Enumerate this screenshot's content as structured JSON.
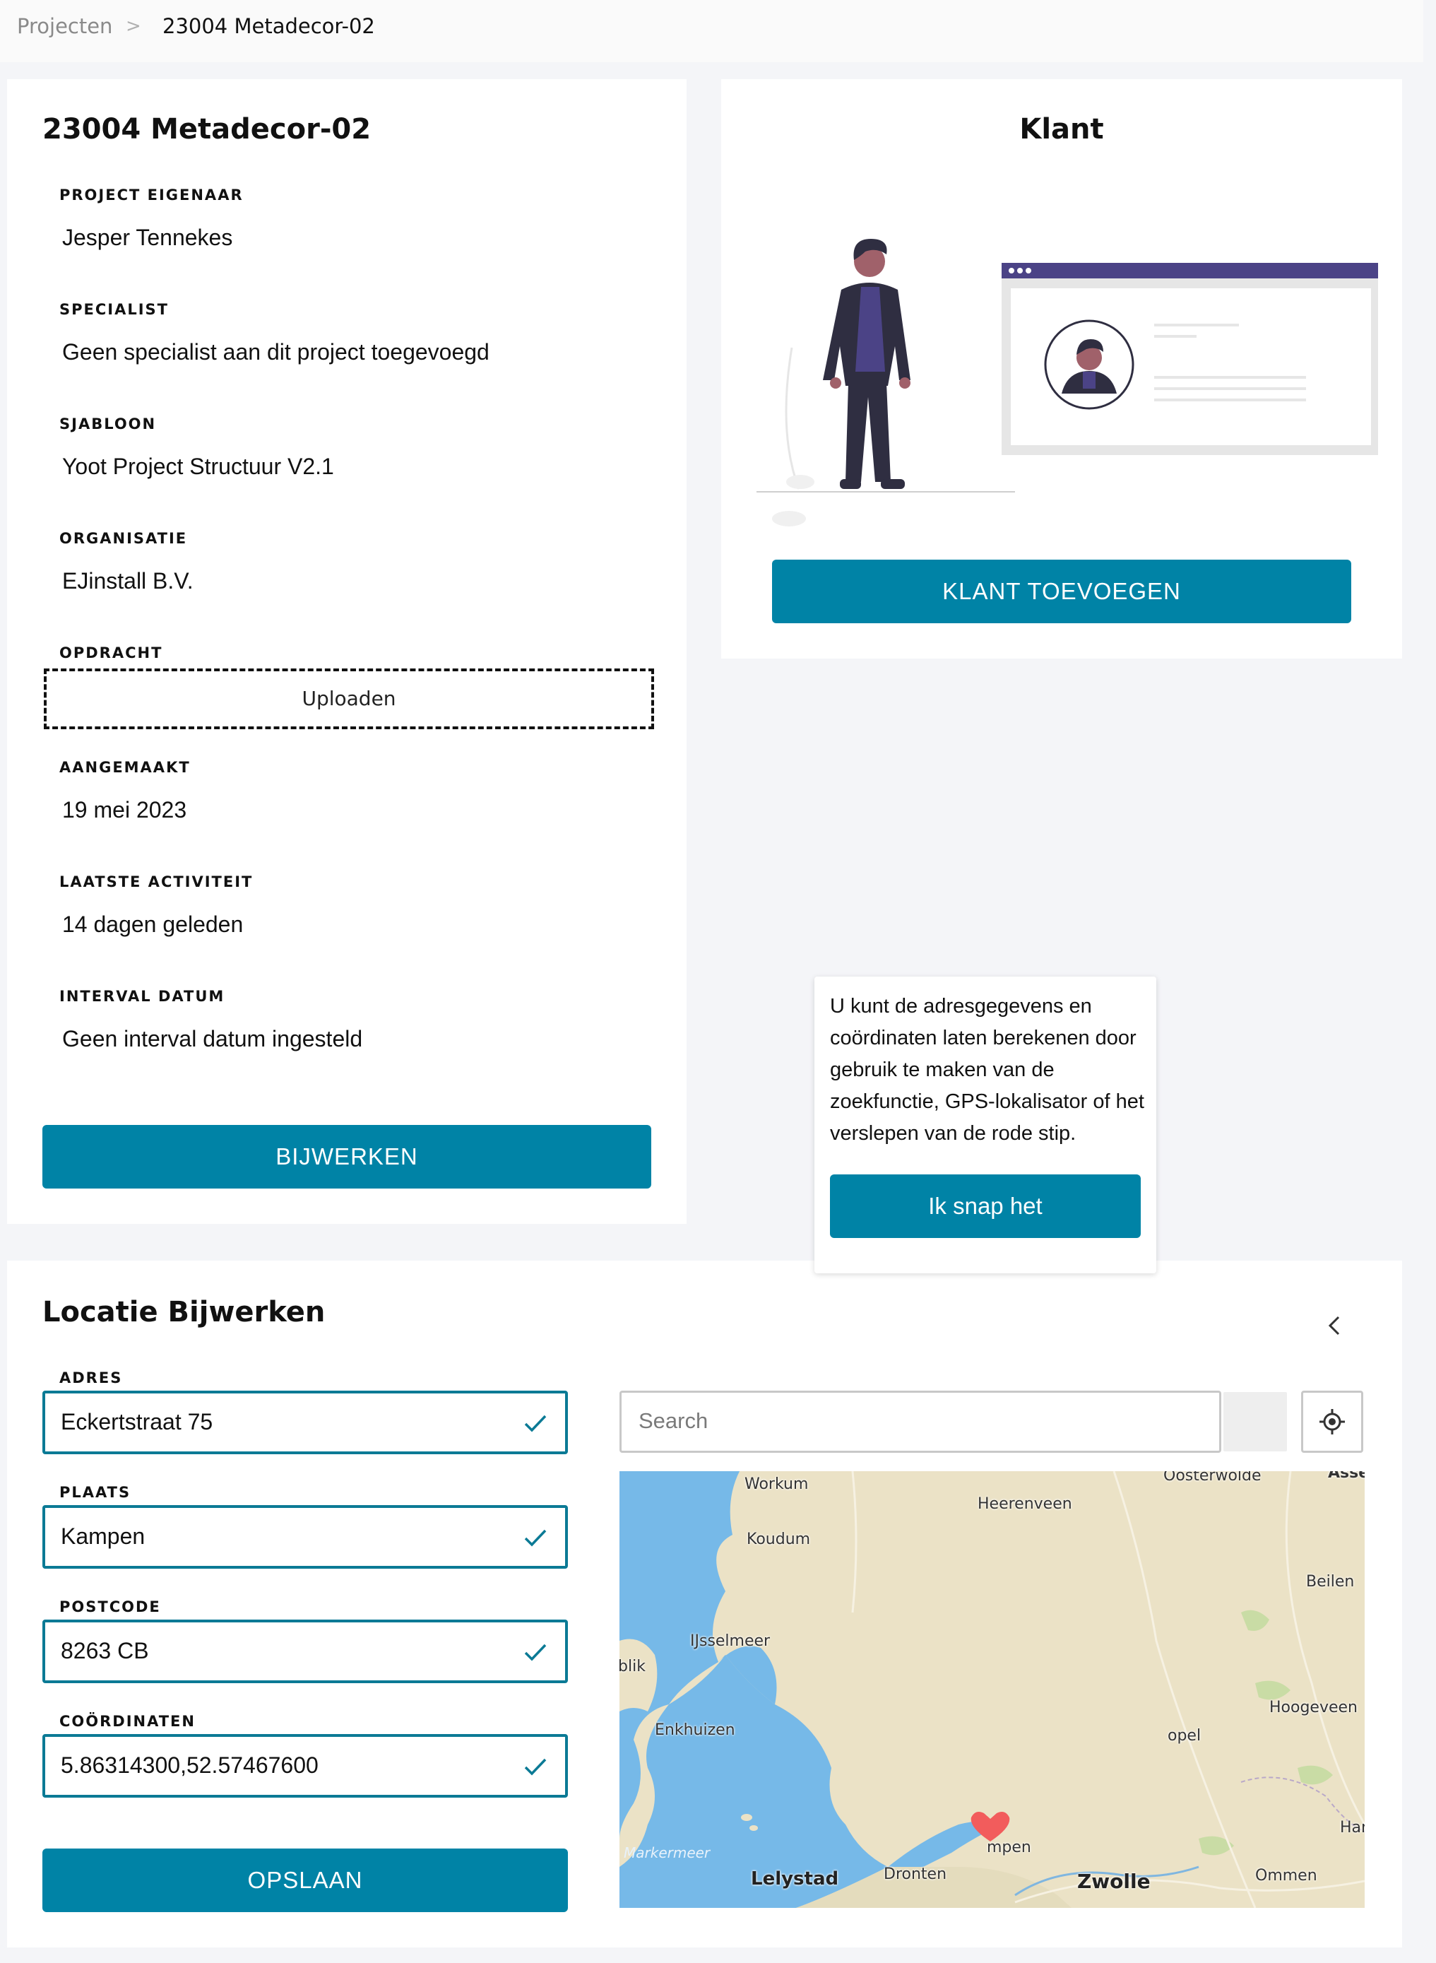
{
  "breadcrumb": {
    "root": "Projecten",
    "separator": ">",
    "current": "23004 Metadecor-02"
  },
  "project": {
    "title": "23004 Metadecor-02",
    "fields": [
      {
        "label": "PROJECT EIGENAAR",
        "value": "Jesper Tennekes"
      },
      {
        "label": "SPECIALIST",
        "value": "Geen specialist aan dit project toegevoegd"
      },
      {
        "label": "SJABLOON",
        "value": "Yoot Project Structuur V2.1"
      },
      {
        "label": "ORGANISATIE",
        "value": "EJinstall B.V."
      },
      {
        "label": "OPDRACHT",
        "upload_label": "Uploaden"
      },
      {
        "label": "AANGEMAAKT",
        "value": "19 mei 2023"
      },
      {
        "label": "LAATSTE ACTIVITEIT",
        "value": "14 dagen geleden"
      },
      {
        "label": "INTERVAL DATUM",
        "value": "Geen interval datum ingesteld"
      }
    ],
    "update_button": "BIJWERKEN"
  },
  "klant": {
    "title": "Klant",
    "add_button": "KLANT TOEVOEGEN"
  },
  "location": {
    "title": "Locatie Bijwerken",
    "fields": [
      {
        "label": "ADRES",
        "value": "Eckertstraat 75"
      },
      {
        "label": "PLAATS",
        "value": "Kampen"
      },
      {
        "label": "POSTCODE",
        "value": "8263 CB"
      },
      {
        "label": "COÖRDINATEN",
        "value": "5.86314300,52.57467600"
      }
    ],
    "save_button": "OPSLAAN",
    "search_placeholder": "Search",
    "map_labels": {
      "workum": "Workum",
      "heerenveen": "Heerenveen",
      "oosterwolde": "Oosterwolde",
      "assen": "Asse",
      "koudum": "Koudum",
      "beilen": "Beilen",
      "ijsselmeer": "IJsselmeer",
      "blik": "blik",
      "enkhuizen": "Enkhuizen",
      "hoogeveen": "Hoogeveen",
      "opel": "opel",
      "markermeer": "Markermeer",
      "kampen": "mpen",
      "lelystad": "Lelystad",
      "dronten": "Dronten",
      "zwolle": "Zwolle",
      "ommen": "Ommen",
      "har": "Har"
    },
    "tooltip_text": "U kunt de adresgegevens en coördinaten laten berekenen door gebruik te maken van de zoekfunctie, GPS-lokalisator of het verslepen van de rode stip.",
    "tooltip_button": "Ik snap het"
  },
  "colors": {
    "primary": "#0083a6",
    "input_border": "#0b7a95",
    "illustration_purple": "#4b4386",
    "marker": "#f25c5c"
  }
}
